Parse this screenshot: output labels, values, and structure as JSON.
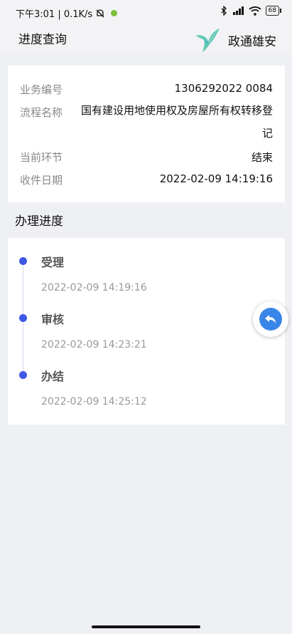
{
  "status_bar": {
    "time_speed": "下午3:01 | 0.1K/s",
    "battery": "68"
  },
  "header": {
    "title": "进度查询",
    "brand_name": "政通雄安"
  },
  "info": {
    "rows": [
      {
        "label": "业务编号",
        "value": "1306292022        0084"
      },
      {
        "label": "流程名称",
        "value": "国有建设用地使用权及房屋所有权转移登记"
      },
      {
        "label": "当前环节",
        "value": "结束"
      },
      {
        "label": "收件日期",
        "value": "2022-02-09 14:19:16"
      }
    ]
  },
  "progress": {
    "section_title": "办理进度",
    "steps": [
      {
        "name": "受理",
        "time": "2022-02-09 14:19:16"
      },
      {
        "name": "审核",
        "time": "2022-02-09 14:23:21"
      },
      {
        "name": "办结",
        "time": "2022-02-09 14:25:12"
      }
    ]
  },
  "colors": {
    "accent": "#3f57e6",
    "fab": "#3a86e8",
    "background": "#eff0f4"
  },
  "icons": {
    "fab": "back-arrow-icon",
    "brand": "bird-logo-icon"
  }
}
